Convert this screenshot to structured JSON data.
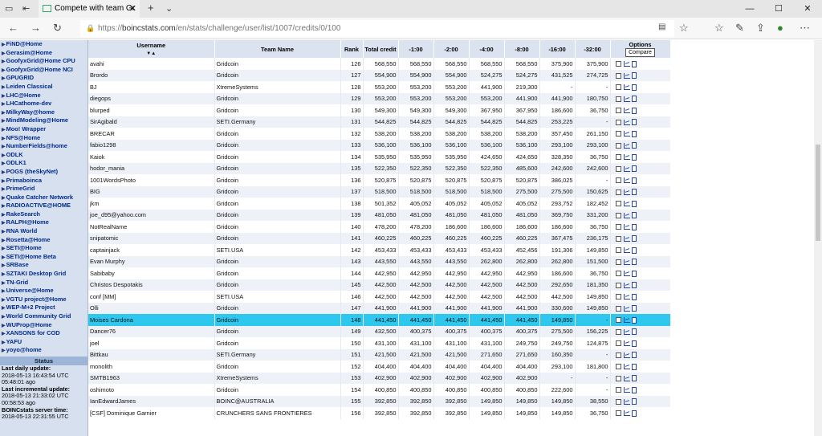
{
  "browser": {
    "tab_title": "Compete with team Gr",
    "url_prefix": "https://",
    "url_domain": "boincstats.com",
    "url_path": "/en/stats/challenge/user/list/1007/credits/0/100"
  },
  "sidebar": {
    "items": [
      "FiND@Home",
      "Gerasim@Home",
      "GoofyxGrid@Home CPU",
      "GoofyxGrid@Home NCI",
      "GPUGRID",
      "Leiden Classical",
      "LHC@Home",
      "LHCathome-dev",
      "MilkyWay@home",
      "MindModeling@Home",
      "Moo! Wrapper",
      "NFS@Home",
      "NumberFields@home",
      "ODLK",
      "ODLK1",
      "POGS (theSkyNet)",
      "Primaboinca",
      "PrimeGrid",
      "Quake Catcher Network",
      "RADIOACTIVE@HOME",
      "RakeSearch",
      "RALPH@Home",
      "RNA World",
      "Rosetta@Home",
      "SETI@Home",
      "SETI@Home Beta",
      "SRBase",
      "SZTAKI Desktop Grid",
      "TN-Grid",
      "Universe@Home",
      "VGTU project@Home",
      "WEP-M+2 Project",
      "World Community Grid",
      "WUProp@Home",
      "XANSONS for COD",
      "YAFU",
      "yoyo@home"
    ],
    "status_header": "Status",
    "status_lines": [
      {
        "label": "Last daily update:",
        "value": "2018-05-13 16:43:54 UTC"
      },
      {
        "label": "",
        "value": "05:48:01 ago"
      },
      {
        "label": "Last incremental update:",
        "value": "2018-05-13 21:33:02 UTC"
      },
      {
        "label": "",
        "value": "00:58:53 ago"
      },
      {
        "label": "BOINCstats server time:",
        "value": "2018-05-13 22:31:55 UTC"
      }
    ]
  },
  "table": {
    "headers": {
      "username": "Username",
      "team": "Team Name",
      "rank": "Rank",
      "total": "Total credit",
      "c1": "-1:00",
      "c2": "-2:00",
      "c4": "-4:00",
      "c8": "-8:00",
      "c16": "-16:00",
      "c32": "-32:00",
      "options": "Options",
      "compare": "Compare"
    },
    "rows": [
      [
        "avahi",
        "Gridcoin",
        "126",
        "568,550",
        "568,550",
        "568,550",
        "568,550",
        "568,550",
        "375,900",
        "375,900"
      ],
      [
        "Brordo",
        "Gridcoin",
        "127",
        "554,900",
        "554,900",
        "554,900",
        "524,275",
        "524,275",
        "431,525",
        "274,725"
      ],
      [
        "BJ",
        "XtremeSystems",
        "128",
        "553,200",
        "553,200",
        "553,200",
        "441,900",
        "219,300",
        "-",
        "-"
      ],
      [
        "diegops",
        "Gridcoin",
        "129",
        "553,200",
        "553,200",
        "553,200",
        "553,200",
        "441,900",
        "441,900",
        "180,750"
      ],
      [
        "blurped",
        "Gridcoin",
        "130",
        "549,300",
        "549,300",
        "549,300",
        "367,950",
        "367,950",
        "186,600",
        "36,750"
      ],
      [
        "SirAgibald",
        "SETI.Germany",
        "131",
        "544,825",
        "544,825",
        "544,825",
        "544,825",
        "544,825",
        "253,225",
        "-"
      ],
      [
        "BRECAR",
        "Gridcoin",
        "132",
        "538,200",
        "538,200",
        "538,200",
        "538,200",
        "538,200",
        "357,450",
        "261,150"
      ],
      [
        "fabio1298",
        "Gridcoin",
        "133",
        "536,100",
        "536,100",
        "536,100",
        "536,100",
        "536,100",
        "293,100",
        "293,100"
      ],
      [
        "Kaiok",
        "Gridcoin",
        "134",
        "535,950",
        "535,950",
        "535,950",
        "424,650",
        "424,650",
        "328,350",
        "36,750"
      ],
      [
        "hodor_mania",
        "Gridcoin",
        "135",
        "522,350",
        "522,350",
        "522,350",
        "522,350",
        "485,600",
        "242,600",
        "242,600"
      ],
      [
        "1001WordsPhoto",
        "Gridcoin",
        "136",
        "520,875",
        "520,875",
        "520,875",
        "520,875",
        "520,875",
        "386,025",
        "-"
      ],
      [
        "BIG",
        "Gridcoin",
        "137",
        "518,500",
        "518,500",
        "518,500",
        "518,500",
        "275,500",
        "275,500",
        "150,625"
      ],
      [
        "jkm",
        "Gridcoin",
        "138",
        "501,352",
        "405,052",
        "405,052",
        "405,052",
        "405,052",
        "293,752",
        "182,452"
      ],
      [
        "joe_d95@yahoo.com",
        "Gridcoin",
        "139",
        "481,050",
        "481,050",
        "481,050",
        "481,050",
        "481,050",
        "369,750",
        "331,200"
      ],
      [
        "NotRealName",
        "Gridcoin",
        "140",
        "478,200",
        "478,200",
        "186,600",
        "186,600",
        "186,600",
        "186,600",
        "36,750"
      ],
      [
        "snipatomic",
        "Gridcoin",
        "141",
        "460,225",
        "460,225",
        "460,225",
        "460,225",
        "460,225",
        "367,475",
        "236,175"
      ],
      [
        "captainjack",
        "SETI.USA",
        "142",
        "453,433",
        "453,433",
        "453,433",
        "453,433",
        "452,456",
        "191,306",
        "149,850"
      ],
      [
        "Evan Murphy",
        "Gridcoin",
        "143",
        "443,550",
        "443,550",
        "443,550",
        "262,800",
        "262,800",
        "262,800",
        "151,500"
      ],
      [
        "Sabibaby",
        "Gridcoin",
        "144",
        "442,950",
        "442,950",
        "442,950",
        "442,950",
        "442,950",
        "186,600",
        "36,750"
      ],
      [
        "Christos Despotakis",
        "Gridcoin",
        "145",
        "442,500",
        "442,500",
        "442,500",
        "442,500",
        "442,500",
        "292,650",
        "181,350"
      ],
      [
        "conf [MM]",
        "SETI.USA",
        "146",
        "442,500",
        "442,500",
        "442,500",
        "442,500",
        "442,500",
        "442,500",
        "149,850"
      ],
      [
        "Olli",
        "Gridcoin",
        "147",
        "441,900",
        "441,900",
        "441,900",
        "441,900",
        "441,900",
        "330,600",
        "149,850"
      ],
      [
        "Moises Cardona",
        "Gridcoin",
        "148",
        "441,450",
        "441,450",
        "441,450",
        "441,450",
        "441,450",
        "149,850",
        "-"
      ],
      [
        "Dancer76",
        "Gridcoin",
        "149",
        "432,500",
        "400,375",
        "400,375",
        "400,375",
        "400,375",
        "275,500",
        "156,225"
      ],
      [
        "joel",
        "Gridcoin",
        "150",
        "431,100",
        "431,100",
        "431,100",
        "431,100",
        "249,750",
        "249,750",
        "124,875"
      ],
      [
        "Bittkau",
        "SETI.Germany",
        "151",
        "421,500",
        "421,500",
        "421,500",
        "271,650",
        "271,650",
        "160,350",
        "-"
      ],
      [
        "monolith",
        "Gridcoin",
        "152",
        "404,400",
        "404,400",
        "404,400",
        "404,400",
        "404,400",
        "293,100",
        "181,800"
      ],
      [
        "SMTB1963",
        "XtremeSystems",
        "153",
        "402,900",
        "402,900",
        "402,900",
        "402,900",
        "402,900",
        "-",
        "-"
      ],
      [
        "oshimoto",
        "Gridcoin",
        "154",
        "400,850",
        "400,850",
        "400,850",
        "400,850",
        "400,850",
        "222,600",
        "-"
      ],
      [
        "IanEdwardJames",
        "BOINC@AUSTRALIA",
        "155",
        "392,850",
        "392,850",
        "392,850",
        "149,850",
        "149,850",
        "149,850",
        "38,550"
      ],
      [
        "[CSF] Dominique Garnier",
        "CRUNCHERS SANS FRONTIERES",
        "156",
        "392,850",
        "392,850",
        "392,850",
        "149,850",
        "149,850",
        "149,850",
        "36,750"
      ]
    ],
    "highlight_index": 22
  }
}
